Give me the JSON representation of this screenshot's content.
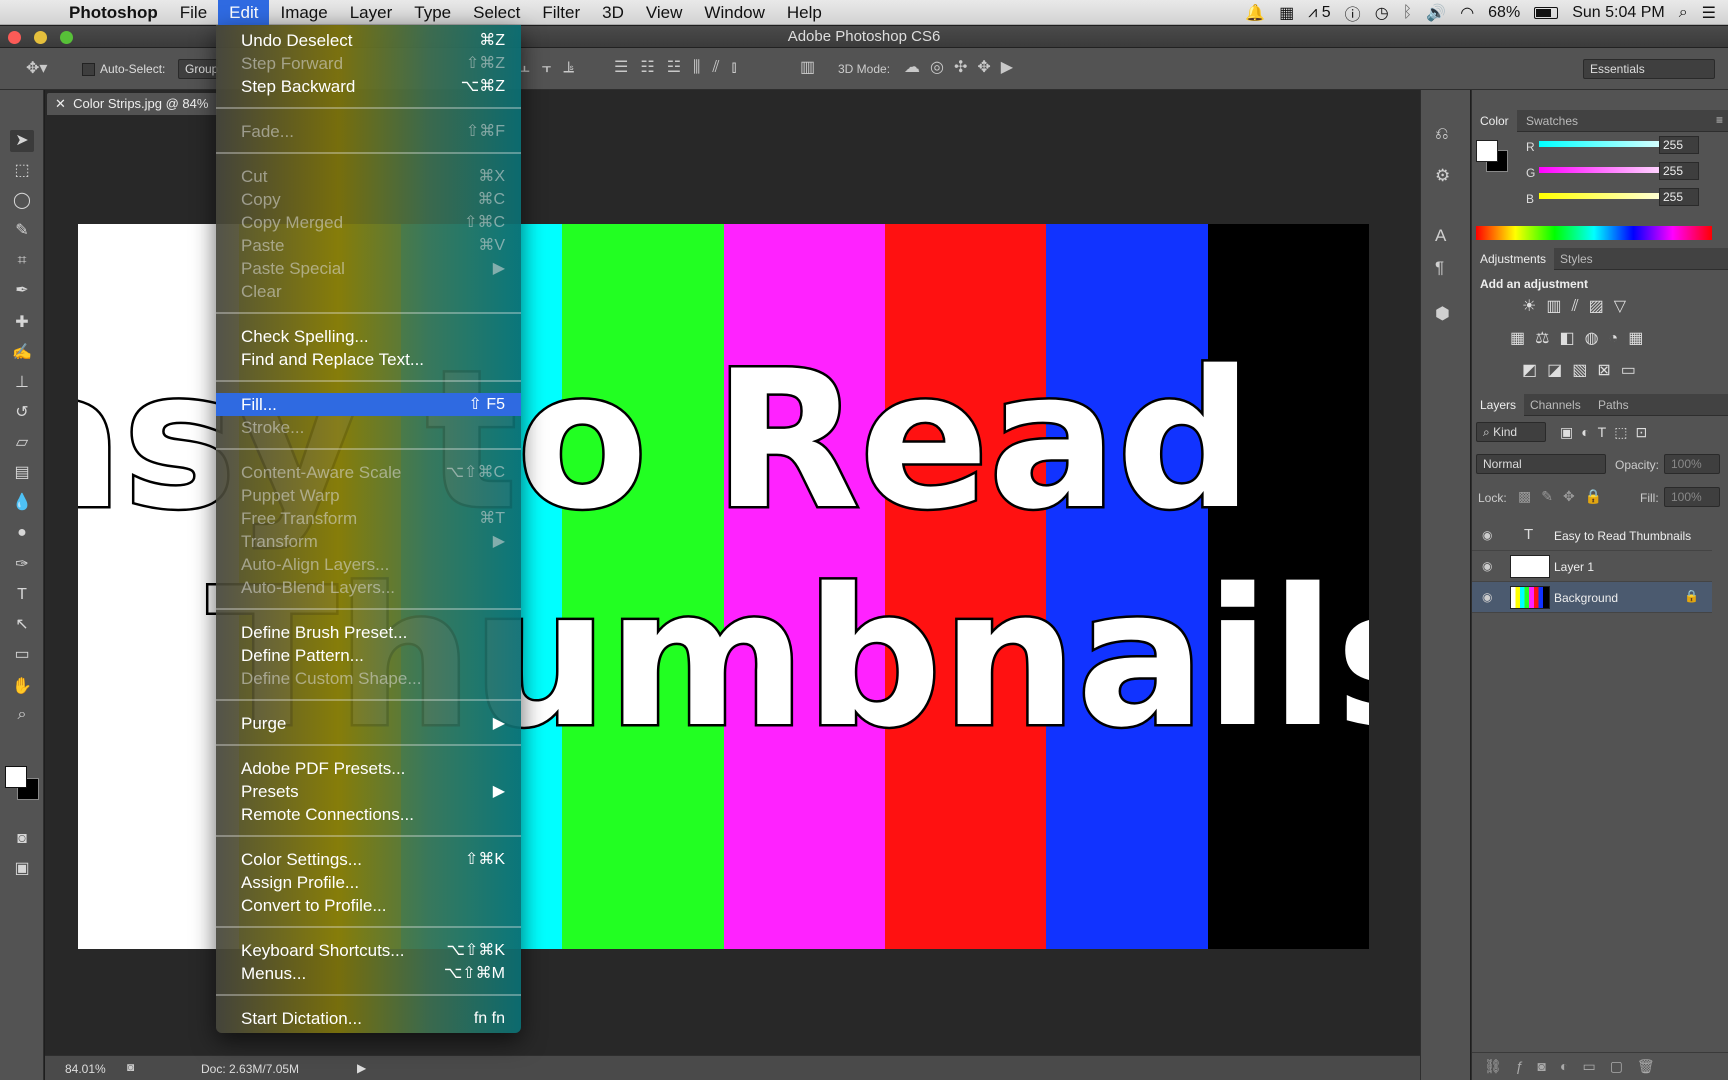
{
  "menubar": {
    "app": "Photoshop",
    "items": [
      "File",
      "Edit",
      "Image",
      "Layer",
      "Type",
      "Select",
      "Filter",
      "3D",
      "View",
      "Window",
      "Help"
    ],
    "active": "Edit",
    "status": {
      "adobe_count": "5",
      "battery": "68%",
      "clock": "Sun 5:04 PM"
    }
  },
  "window": {
    "title": "Adobe Photoshop CS6"
  },
  "options": {
    "auto_select": "Auto-Select:",
    "group": "Group",
    "mode_3d": "3D Mode:",
    "workspace": "Essentials"
  },
  "document": {
    "tab": "Color Strips.jpg @ 84%",
    "line1": "Easy to Read",
    "line2": "Thumbnails",
    "zoom": "84.01%",
    "doc_size": "Doc: 2.63M/7.05M"
  },
  "strips": [
    {
      "color": "#ffffff"
    },
    {
      "color": "#ffff00"
    },
    {
      "color": "#00ffff"
    },
    {
      "color": "#22ff22"
    },
    {
      "color": "#ff22ff"
    },
    {
      "color": "#ff1111"
    },
    {
      "color": "#1133ff"
    },
    {
      "color": "#000000"
    }
  ],
  "edit_menu": {
    "items": [
      {
        "label": "Undo Deselect",
        "shortcut": "⌘Z",
        "disabled": false
      },
      {
        "label": "Step Forward",
        "shortcut": "⇧⌘Z",
        "disabled": true
      },
      {
        "label": "Step Backward",
        "shortcut": "⌥⌘Z",
        "disabled": false
      },
      {
        "label": "Fade...",
        "shortcut": "⇧⌘F",
        "disabled": true
      },
      {
        "label": "Cut",
        "shortcut": "⌘X",
        "disabled": true
      },
      {
        "label": "Copy",
        "shortcut": "⌘C",
        "disabled": true
      },
      {
        "label": "Copy Merged",
        "shortcut": "⇧⌘C",
        "disabled": true
      },
      {
        "label": "Paste",
        "shortcut": "⌘V",
        "disabled": true
      },
      {
        "label": "Paste Special",
        "shortcut": "▶",
        "disabled": true
      },
      {
        "label": "Clear",
        "shortcut": "",
        "disabled": true
      },
      {
        "label": "Check Spelling...",
        "shortcut": "",
        "disabled": false
      },
      {
        "label": "Find and Replace Text...",
        "shortcut": "",
        "disabled": false
      },
      {
        "label": "Fill...",
        "shortcut": "⇧ F5",
        "disabled": false,
        "highlighted": true
      },
      {
        "label": "Stroke...",
        "shortcut": "",
        "disabled": true
      },
      {
        "label": "Content-Aware Scale",
        "shortcut": "⌥⇧⌘C",
        "disabled": true
      },
      {
        "label": "Puppet Warp",
        "shortcut": "",
        "disabled": true
      },
      {
        "label": "Free Transform",
        "shortcut": "⌘T",
        "disabled": true
      },
      {
        "label": "Transform",
        "shortcut": "▶",
        "disabled": true
      },
      {
        "label": "Auto-Align Layers...",
        "shortcut": "",
        "disabled": true
      },
      {
        "label": "Auto-Blend Layers...",
        "shortcut": "",
        "disabled": true
      },
      {
        "label": "Define Brush Preset...",
        "shortcut": "",
        "disabled": false
      },
      {
        "label": "Define Pattern...",
        "shortcut": "",
        "disabled": false
      },
      {
        "label": "Define Custom Shape...",
        "shortcut": "",
        "disabled": true
      },
      {
        "label": "Purge",
        "shortcut": "▶",
        "disabled": false
      },
      {
        "label": "Adobe PDF Presets...",
        "shortcut": "",
        "disabled": false
      },
      {
        "label": "Presets",
        "shortcut": "▶",
        "disabled": false
      },
      {
        "label": "Remote Connections...",
        "shortcut": "",
        "disabled": false
      },
      {
        "label": "Color Settings...",
        "shortcut": "⇧⌘K",
        "disabled": false
      },
      {
        "label": "Assign Profile...",
        "shortcut": "",
        "disabled": false
      },
      {
        "label": "Convert to Profile...",
        "shortcut": "",
        "disabled": false
      },
      {
        "label": "Keyboard Shortcuts...",
        "shortcut": "⌥⇧⌘K",
        "disabled": false
      },
      {
        "label": "Menus...",
        "shortcut": "⌥⇧⌘M",
        "disabled": false
      },
      {
        "label": "Start Dictation...",
        "shortcut": "fn fn",
        "disabled": false
      }
    ]
  },
  "color_panel": {
    "tabs": [
      "Color",
      "Swatches"
    ],
    "r": "255",
    "g": "255",
    "b": "255",
    "labels": [
      "R",
      "G",
      "B"
    ]
  },
  "adjustments": {
    "tabs": [
      "Adjustments",
      "Styles"
    ],
    "heading": "Add an adjustment"
  },
  "layers_panel": {
    "tabs": [
      "Layers",
      "Channels",
      "Paths"
    ],
    "kind": "Kind",
    "blend": "Normal",
    "opacity_label": "Opacity:",
    "opacity": "100%",
    "lock_label": "Lock:",
    "fill_label": "Fill:",
    "fill": "100%",
    "layers": [
      {
        "name": "Easy to Read Thumbnails",
        "type": "text"
      },
      {
        "name": "Layer 1",
        "type": "image"
      },
      {
        "name": "Background",
        "type": "image",
        "selected": true
      }
    ]
  }
}
